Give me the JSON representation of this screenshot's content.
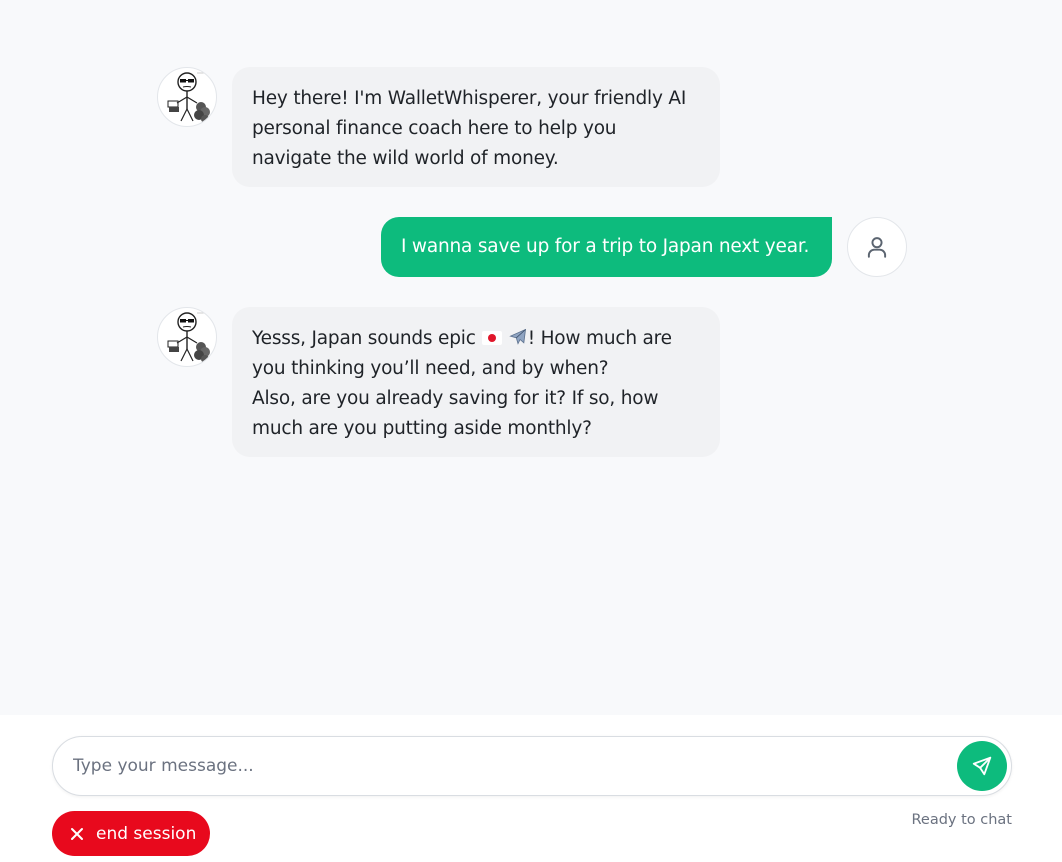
{
  "messages": [
    {
      "role": "bot",
      "lines": [
        "Hey there! I'm WalletWhisperer, your friendly AI",
        "personal finance coach here to help you",
        "navigate the wild world of money."
      ]
    },
    {
      "role": "user",
      "text": "I wanna save up for a trip to Japan next year."
    },
    {
      "role": "bot",
      "line1_before": "Yesss, Japan sounds epic",
      "line1_after": "! How much are",
      "lines": [
        "you thinking you’ll need, and by when?",
        "Also, are you already saving for it? If so, how",
        "much are you putting aside monthly?"
      ]
    }
  ],
  "composer": {
    "placeholder": "Type your message...",
    "value": ""
  },
  "end_session_label": "end session",
  "status_text": "Ready to chat",
  "colors": {
    "accent": "#0dbb7d",
    "danger": "#e8091d",
    "bot_bubble": "#f1f2f4"
  },
  "icons": {
    "bot_avatar": "stick-figure-sunglasses-money-icon",
    "user_avatar": "user-icon",
    "send": "send-icon",
    "close": "close-icon"
  }
}
